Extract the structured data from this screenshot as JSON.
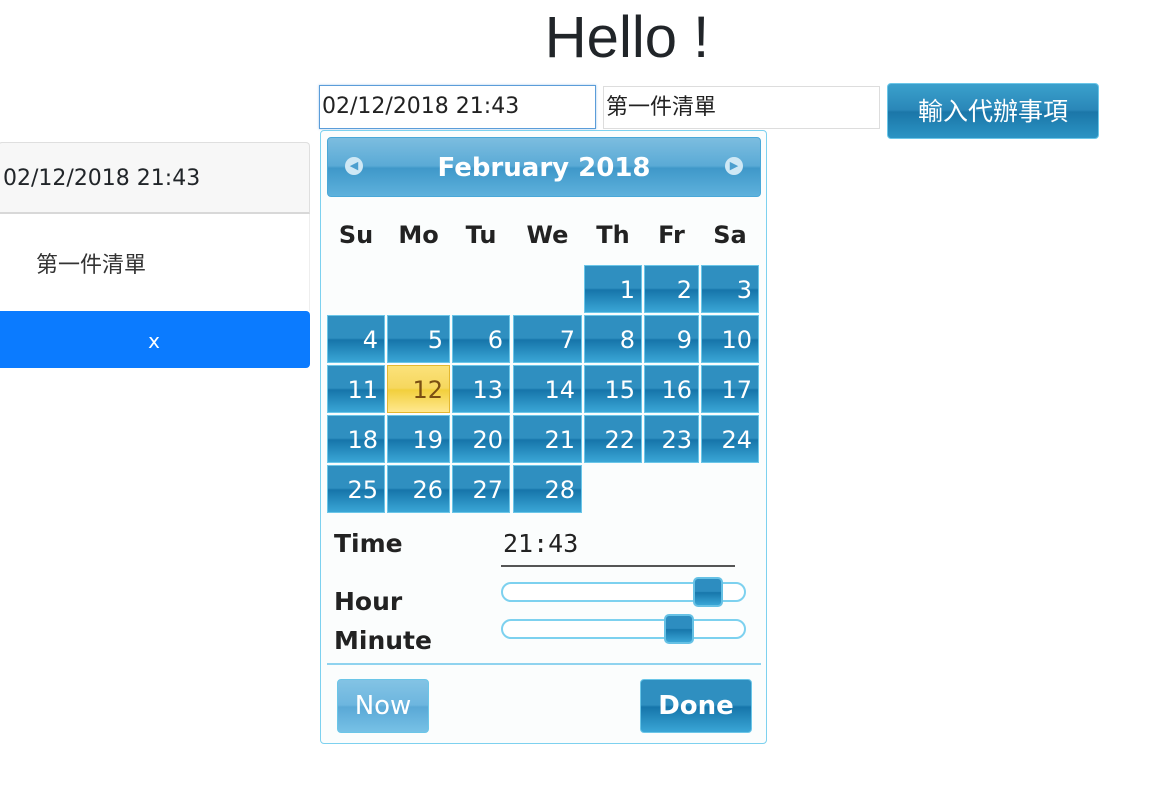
{
  "page": {
    "title": "Hello !"
  },
  "form": {
    "date_value": "02/12/2018 21:43",
    "text_value": "第一件清單",
    "add_button_label": "輸入代辦事項"
  },
  "todo_list": {
    "date": "02/12/2018 21:43",
    "item_text": "第一件清單",
    "delete_label": "x"
  },
  "datepicker": {
    "month_year": "February 2018",
    "prev_icon": "prev-month-icon",
    "next_icon": "next-month-icon",
    "weekdays": [
      "Su",
      "Mo",
      "Tu",
      "We",
      "Th",
      "Fr",
      "Sa"
    ],
    "days": [
      1,
      2,
      3,
      4,
      5,
      6,
      7,
      8,
      9,
      10,
      11,
      12,
      13,
      14,
      15,
      16,
      17,
      18,
      19,
      20,
      21,
      22,
      23,
      24,
      25,
      26,
      27,
      28
    ],
    "first_weekday_index": 4,
    "selected_day": 12,
    "time_label": "Time",
    "time_value": "21:43",
    "hour_label": "Hour",
    "minute_label": "Minute",
    "hour_value": 21,
    "minute_value": 43,
    "now_label": "Now",
    "done_label": "Done"
  },
  "colors": {
    "accent": "#2f8fc0",
    "highlight": "#f6d75e",
    "delete": "#0b7bff"
  }
}
